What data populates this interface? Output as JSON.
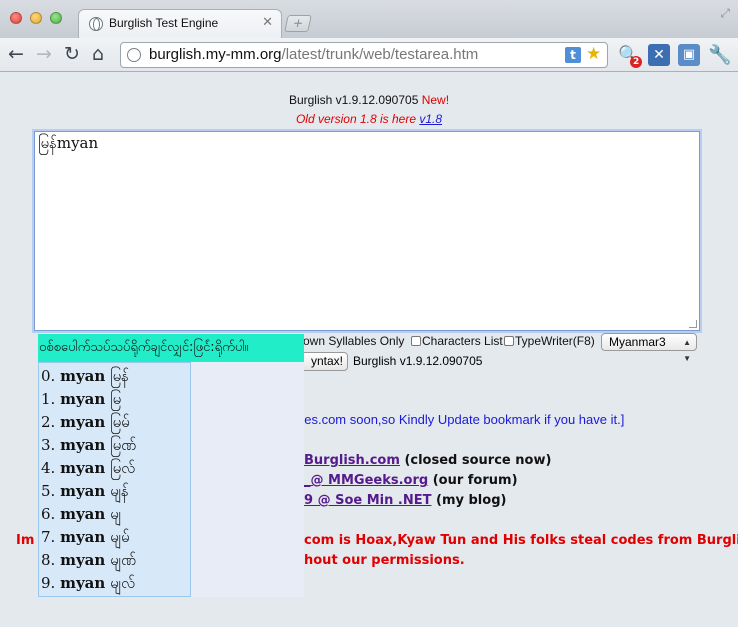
{
  "browser": {
    "tab_title": "Burglish Test Engine",
    "tab_close": "✕",
    "new_tab": "+",
    "url_host": "burglish.my-mm.org",
    "url_path": "/latest/trunk/web/testarea.htm",
    "ext_badge": "2",
    "icons": [
      "back-arrow-icon",
      "forward-arrow-icon",
      "reload-icon",
      "home-icon",
      "globe-icon",
      "star-icon",
      "wrench-icon"
    ]
  },
  "header": {
    "version": "Burglish v1.9.12.090705",
    "new_label": "New!",
    "old_text": "Old version 1.8 is here",
    "old_link": "v1.8"
  },
  "editor": {
    "text": "မြန်myan"
  },
  "options": {
    "syllables": "own Syllables Only",
    "characters": "Characters List",
    "typewriter": "TypeWriter(F8)",
    "font_select": "Myanmar3",
    "syntax_button": "yntax!",
    "version": "Burglish v1.9.12.090705"
  },
  "content": {
    "notice": "ges.com soon,so Kindly Update bookmark if you have it.]",
    "link1": "Burglish.com",
    "link1_suffix": " (closed source now)",
    "link2": "_@ MMGeeks.org",
    "link2_suffix": " (our forum)",
    "link3": "9 @ Soe Min .NET",
    "link3_suffix": " (my blog)",
    "warn_prefix": "Im",
    "warn_line1": "com is Hoax,Kyaw Tun and His folks steal codes from Burglish",
    "warn_line2": "hout our permissions."
  },
  "suggestions": {
    "header": "ဝစ်စပေါက်သပ်သပ်ရိုက်ချင်လျှင်:ဖြင်ံ:ရိုက်ပါ။",
    "items": [
      {
        "index": "0.",
        "roman": "myan",
        "burmese": "မြန်"
      },
      {
        "index": "1.",
        "roman": "myan",
        "burmese": "မြ"
      },
      {
        "index": "2.",
        "roman": "myan",
        "burmese": "မြမ်"
      },
      {
        "index": "3.",
        "roman": "myan",
        "burmese": "မြဏ်"
      },
      {
        "index": "4.",
        "roman": "myan",
        "burmese": "မြလ်"
      },
      {
        "index": "5.",
        "roman": "myan",
        "burmese": "မျန်"
      },
      {
        "index": "6.",
        "roman": "myan",
        "burmese": "မျ"
      },
      {
        "index": "7.",
        "roman": "myan",
        "burmese": "မျမ်"
      },
      {
        "index": "8.",
        "roman": "myan",
        "burmese": "မျဏ်"
      },
      {
        "index": "9.",
        "roman": "myan",
        "burmese": "မျလ်"
      }
    ]
  }
}
